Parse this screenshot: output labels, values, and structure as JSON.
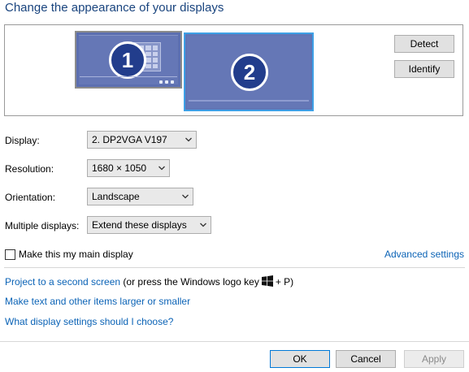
{
  "header": {
    "title": "Change the appearance of your displays"
  },
  "arrangement": {
    "monitors": [
      {
        "number": "1"
      },
      {
        "number": "2"
      }
    ],
    "detect_label": "Detect",
    "identify_label": "Identify"
  },
  "settings": {
    "display": {
      "label": "Display:",
      "value": "2. DP2VGA  V197"
    },
    "resolution": {
      "label": "Resolution:",
      "value": "1680 × 1050"
    },
    "orientation": {
      "label": "Orientation:",
      "value": "Landscape"
    },
    "multiple": {
      "label": "Multiple displays:",
      "value": "Extend these displays"
    }
  },
  "main_display": {
    "label": "Make this my main display",
    "checked": false
  },
  "advanced_label": "Advanced settings",
  "links": {
    "project_link": "Project to a second screen",
    "project_suffix_a": "(or press the Windows logo key",
    "project_suffix_b": "+ P)",
    "text_size": "Make text and other items larger or smaller",
    "help": "What display settings should I choose?"
  },
  "buttons": {
    "ok": "OK",
    "cancel": "Cancel",
    "apply": "Apply"
  },
  "colors": {
    "title": "#19447e",
    "link": "#0b63b6",
    "monitor_fill": "#5f74b5",
    "selected_border": "#3da0e6",
    "badge": "#223d8c"
  },
  "icons": {
    "windows_logo": "windows-logo-icon",
    "dropdown": "chevron-down-icon"
  }
}
